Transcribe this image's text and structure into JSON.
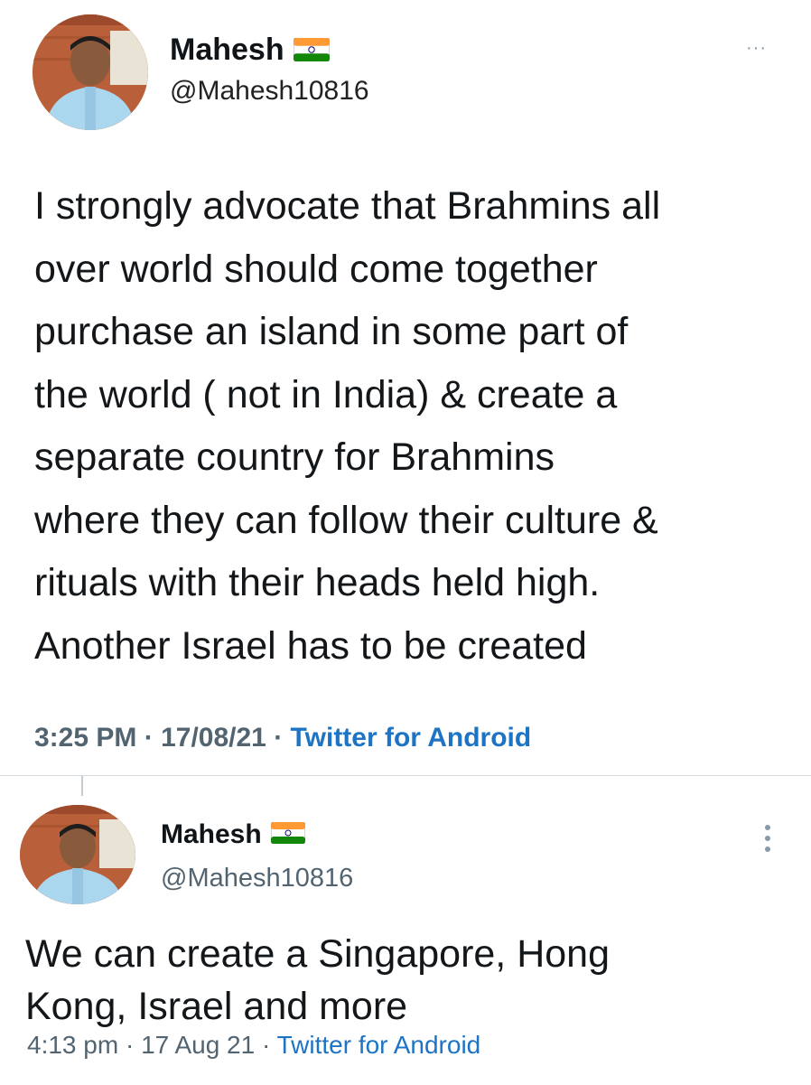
{
  "tweet1": {
    "name": "Mahesh",
    "handle": "@Mahesh10816",
    "body": "I strongly advocate that Brahmins all\nover world should come together\npurchase an island in some part of\nthe world ( not in India) & create a\nseparate country for Brahmins\nwhere they can follow their culture &\nrituals with their heads held high.\nAnother Israel has to be created",
    "time": "3:25 PM",
    "separator": "·",
    "date": "17/08/21",
    "source": "Twitter for Android",
    "more_icon": "···"
  },
  "tweet2": {
    "name": "Mahesh",
    "handle": "@Mahesh10816",
    "body": "We can create a Singapore,  Hong\nKong,  Israel and more",
    "time": "4:13 pm",
    "separator": "·",
    "date": "17 Aug 21",
    "source": "Twitter for Android",
    "more_icon": "⋮"
  },
  "colors": {
    "source_link": "#1d73c4",
    "meta_text": "#536471",
    "flag_saffron": "#ff9933",
    "flag_green": "#138808",
    "flag_chakra": "#000080"
  },
  "icons": {
    "flag": "india-flag-icon",
    "avatar": "profile-avatar",
    "more": "more-options-icon"
  }
}
